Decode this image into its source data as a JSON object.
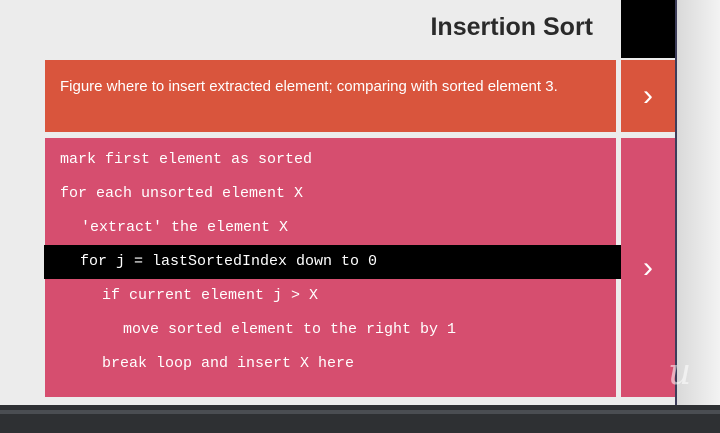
{
  "header": {
    "title": "Insertion Sort"
  },
  "status": {
    "message": "Figure where to insert extracted element; comparing with sorted element 3.",
    "toggle_glyph": "›"
  },
  "pseudocode": {
    "toggle_glyph": "›",
    "lines": [
      {
        "indent": 0,
        "text": "mark first element as sorted",
        "active": false
      },
      {
        "indent": 0,
        "text": "for each unsorted element X",
        "active": false
      },
      {
        "indent": 1,
        "text": "'extract' the element X",
        "active": false
      },
      {
        "indent": 1,
        "text": "for j = lastSortedIndex down to 0",
        "active": true
      },
      {
        "indent": 2,
        "text": "if current element j > X",
        "active": false
      },
      {
        "indent": 3,
        "text": "move sorted element to the right by 1",
        "active": false
      },
      {
        "indent": 2,
        "text": "break loop and insert X here",
        "active": false
      }
    ]
  },
  "colors": {
    "status_bg": "#d9553d",
    "pseudocode_bg": "#d64e6f",
    "active_line_bg": "#000000"
  },
  "watermark": {
    "text": "u"
  }
}
